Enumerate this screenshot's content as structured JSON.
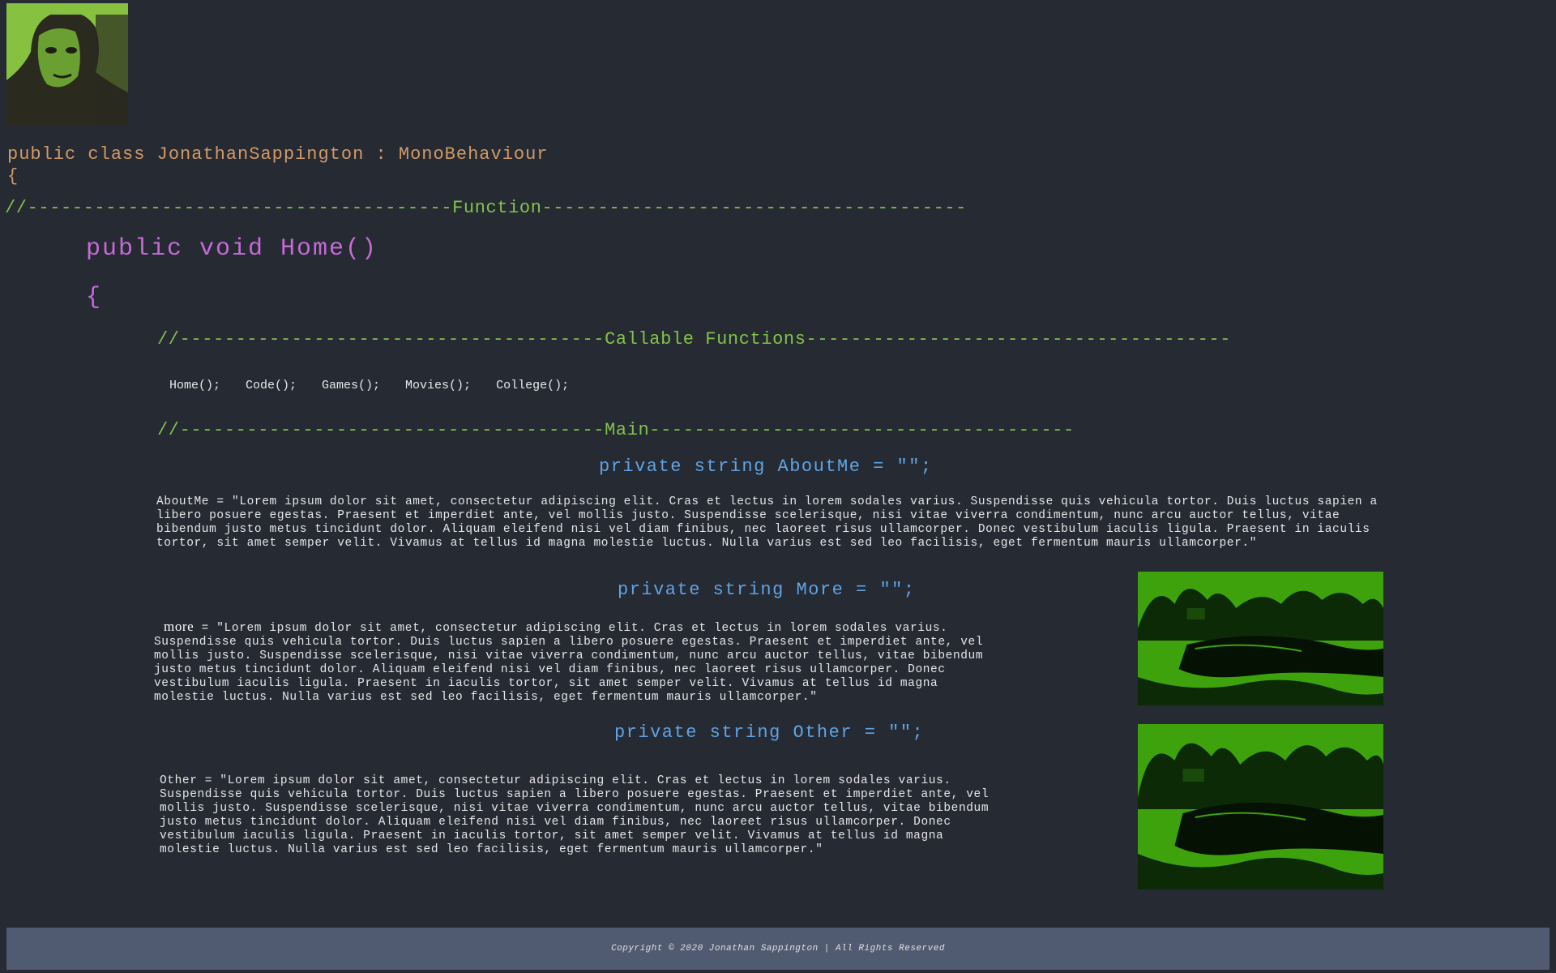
{
  "header": {
    "class_declaration": "public class JonathanSappington : MonoBehaviour",
    "open_brace": "{"
  },
  "dividers": {
    "function": "//--------------------------------------Function--------------------------------------",
    "callable": "//--------------------------------------Callable Functions--------------------------------------",
    "main": "//--------------------------------------Main--------------------------------------"
  },
  "method": {
    "signature": "public void Home()",
    "open_brace": "{"
  },
  "nav": {
    "items": [
      "Home();",
      "Code();",
      "Games();",
      "Movies();",
      "College();"
    ]
  },
  "sections": {
    "about": {
      "heading": "private string AboutMe = \"\";",
      "text": "AboutMe = \"Lorem ipsum dolor sit amet, consectetur adipiscing elit. Cras et lectus in lorem sodales varius. Suspendisse quis vehicula tortor. Duis luctus sapien a libero posuere egestas. Praesent et imperdiet ante, vel mollis justo. Suspendisse scelerisque, nisi vitae viverra condimentum, nunc arcu auctor tellus, vitae bibendum justo metus tincidunt dolor. Aliquam eleifend nisi vel diam finibus, nec laoreet risus ullamcorper. Donec vestibulum iaculis ligula. Praesent in iaculis tortor, sit amet semper velit. Vivamus at tellus id magna molestie luctus. Nulla varius est sed leo facilisis, eget fermentum mauris ullamcorper.\""
    },
    "more": {
      "heading": "private string More = \"\";",
      "key": "more",
      "text": " = \"Lorem ipsum dolor sit amet, consectetur adipiscing elit. Cras et lectus in lorem sodales varius. Suspendisse quis vehicula tortor. Duis luctus sapien a libero posuere egestas. Praesent et imperdiet ante, vel mollis justo. Suspendisse scelerisque, nisi vitae viverra condimentum, nunc arcu auctor tellus, vitae bibendum justo metus tincidunt dolor. Aliquam eleifend nisi vel diam finibus, nec laoreet risus ullamcorper. Donec vestibulum iaculis ligula. Praesent in iaculis tortor, sit amet semper velit. Vivamus at tellus id magna molestie luctus. Nulla varius est sed leo facilisis, eget fermentum mauris ullamcorper.\""
    },
    "other": {
      "heading": "private string Other = \"\";",
      "text": "Other = \"Lorem ipsum dolor sit amet, consectetur adipiscing elit. Cras et lectus in lorem sodales varius. Suspendisse quis vehicula tortor. Duis luctus sapien a libero posuere egestas. Praesent et imperdiet ante, vel mollis justo. Suspendisse scelerisque, nisi vitae viverra condimentum, nunc arcu auctor tellus, vitae bibendum justo metus tincidunt dolor. Aliquam eleifend nisi vel diam finibus, nec laoreet risus ullamcorper. Donec vestibulum iaculis ligula. Praesent in iaculis tortor, sit amet semper velit. Vivamus at tellus id magna molestie luctus. Nulla varius est sed leo facilisis, eget fermentum mauris ullamcorper.\""
    }
  },
  "footer": {
    "copyright": "Copyright © 2020 Jonathan Sappington | All Rights Reserved"
  },
  "colors": {
    "background": "#262a33",
    "class_text": "#d19a66",
    "comment": "#82c34a",
    "method": "#c56ad6",
    "heading": "#5fa4e6",
    "footer_bg": "#505a70"
  }
}
